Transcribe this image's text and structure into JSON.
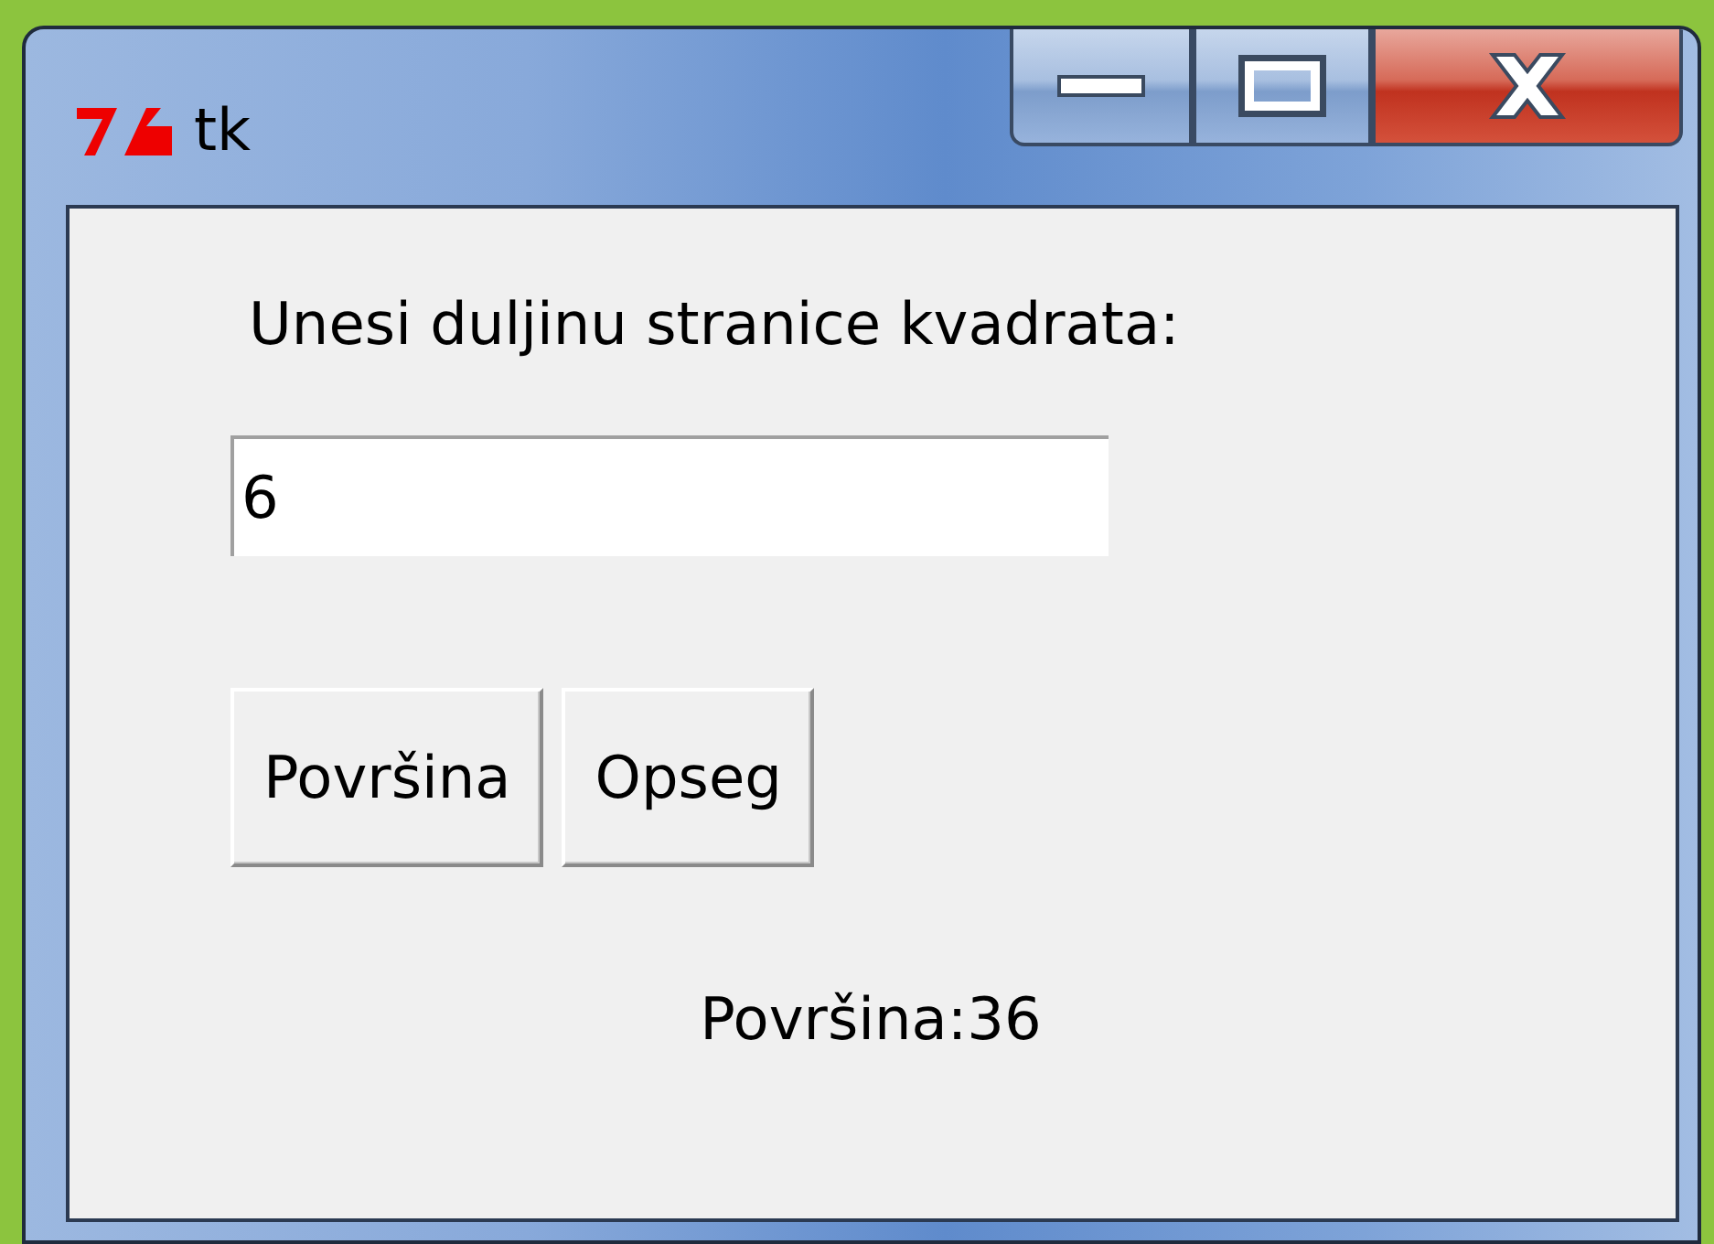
{
  "window": {
    "title": "tk"
  },
  "prompt": "Unesi duljinu stranice kvadrata:",
  "entry": {
    "value": "6"
  },
  "buttons": [
    "Površina",
    "Opseg"
  ],
  "result": "Površina:36"
}
